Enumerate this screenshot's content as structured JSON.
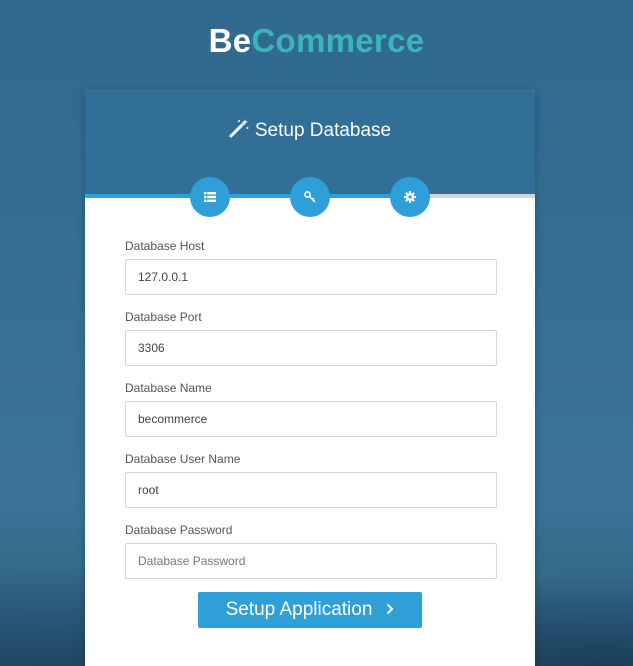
{
  "brand": {
    "part1": "Be",
    "part2": "Commerce"
  },
  "card": {
    "title": "Setup Database",
    "title_icon": "magic-wand-icon"
  },
  "steps": [
    {
      "icon": "database-list-icon",
      "state": "active"
    },
    {
      "icon": "key-icon",
      "state": "active"
    },
    {
      "icon": "gear-icon",
      "state": "active"
    }
  ],
  "progress": {
    "completed_fraction": 0.76
  },
  "form": {
    "fields": [
      {
        "label": "Database Host",
        "value": "127.0.0.1",
        "placeholder": ""
      },
      {
        "label": "Database Port",
        "value": "3306",
        "placeholder": ""
      },
      {
        "label": "Database Name",
        "value": "becommerce",
        "placeholder": ""
      },
      {
        "label": "Database User Name",
        "value": "root",
        "placeholder": ""
      },
      {
        "label": "Database Password",
        "value": "",
        "placeholder": "Database Password"
      }
    ],
    "submit_label": "Setup Application",
    "submit_icon": "chevron-right-icon"
  },
  "colors": {
    "background": "#326f97",
    "accent": "#2f9fd8",
    "brand_teal": "#3ab5b8"
  }
}
